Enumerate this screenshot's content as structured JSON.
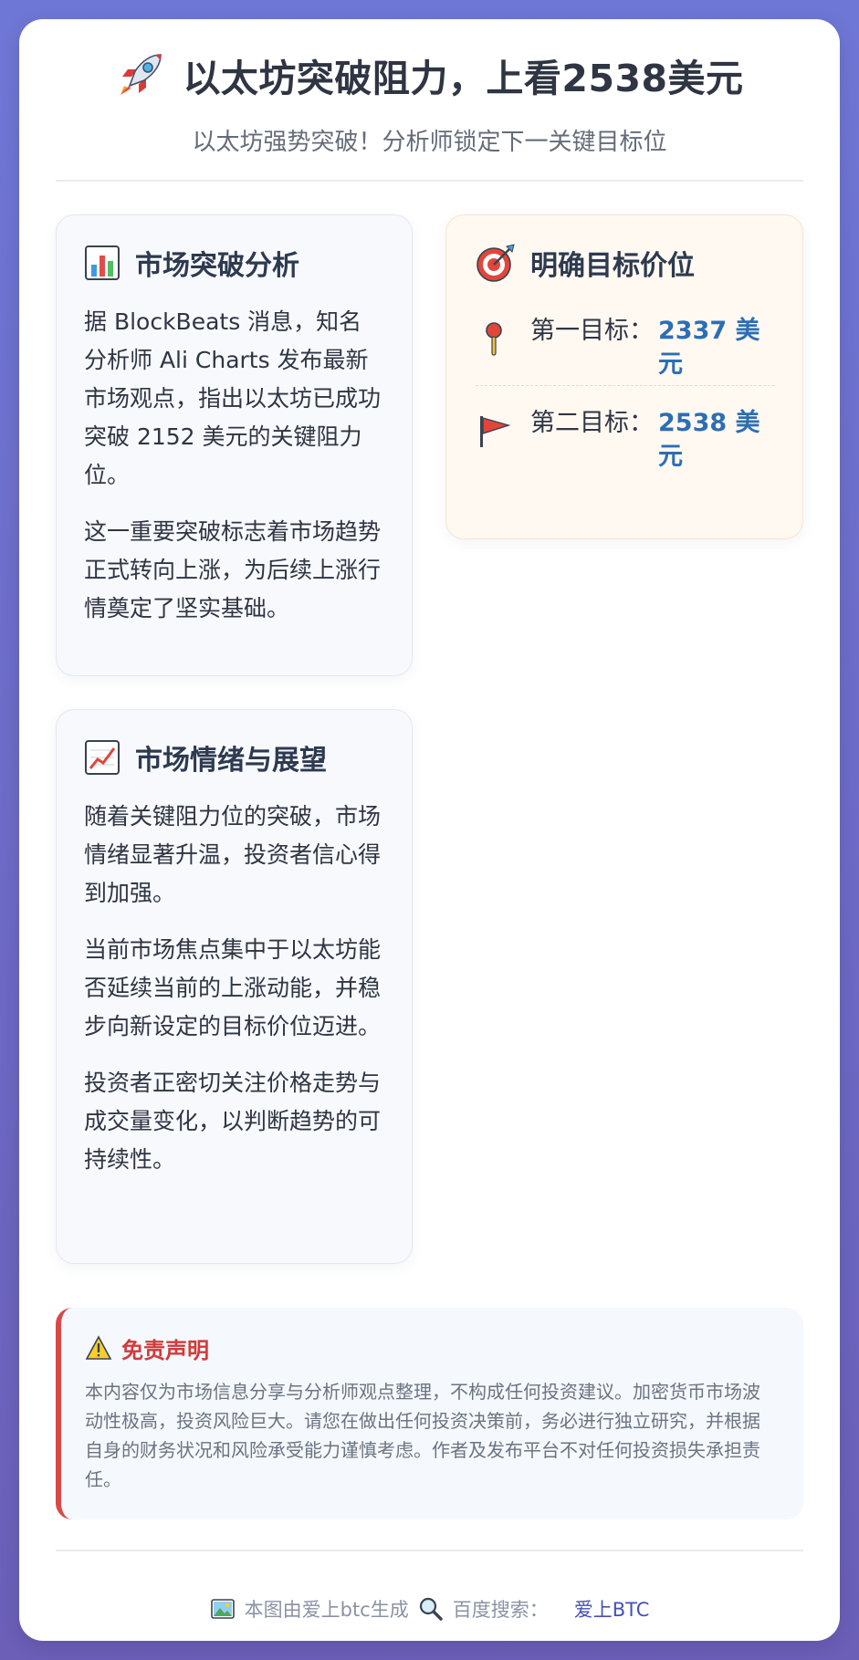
{
  "header": {
    "title": "以太坊突破阻力，上看2538美元",
    "subtitle": "以太坊强势突破！分析师锁定下一关键目标位",
    "icon": "rocket-icon"
  },
  "breakthrough": {
    "icon": "bar-chart-icon",
    "heading": "市场突破分析",
    "paragraphs": [
      "据 BlockBeats 消息，知名分析师 Ali Charts 发布最新市场观点，指出以太坊已成功突破 2152 美元的关键阻力位。",
      "这一重要突破标志着市场趋势正式转向上涨，为后续上涨行情奠定了坚实基础。"
    ]
  },
  "targets": {
    "icon": "target-icon",
    "heading": "明确目标价位",
    "items": [
      {
        "icon": "pin-icon",
        "label": "第一目标：",
        "value": "2337 美元"
      },
      {
        "icon": "flag-icon",
        "label": "第二目标：",
        "value": "2538 美元"
      }
    ],
    "accent_color": "#2d6eb3"
  },
  "outlook": {
    "icon": "trending-up-icon",
    "heading": "市场情绪与展望",
    "paragraphs": [
      "随着关键阻力位的突破，市场情绪显著升温，投资者信心得到加强。",
      "当前市场焦点集中于以太坊能否延续当前的上涨动能，并稳步向新设定的目标价位迈进。",
      "投资者正密切关注价格走势与成交量变化，以判断趋势的可持续性。"
    ]
  },
  "disclaimer": {
    "icon": "warning-icon",
    "heading": "免责声明",
    "text": "本内容仅为市场信息分享与分析师观点整理，不构成任何投资建议。加密货币市场波动性极高，投资风险巨大。请您在做出任何投资决策前，务必进行独立研究，并根据自身的财务状况和风险承受能力谨慎考虑。作者及发布平台不对任何投资损失承担责任。",
    "accent_color": "#d84848"
  },
  "footer": {
    "generated_text": "本图由爱上btc生成",
    "search_text": "百度搜索：",
    "brand": "爱上BTC",
    "image_icon": "picture-icon",
    "search_icon": "magnifier-icon"
  },
  "colors": {
    "background_top": "#6f77d6",
    "background_bottom": "#6b5fb8",
    "brand_link": "#4550b5"
  }
}
